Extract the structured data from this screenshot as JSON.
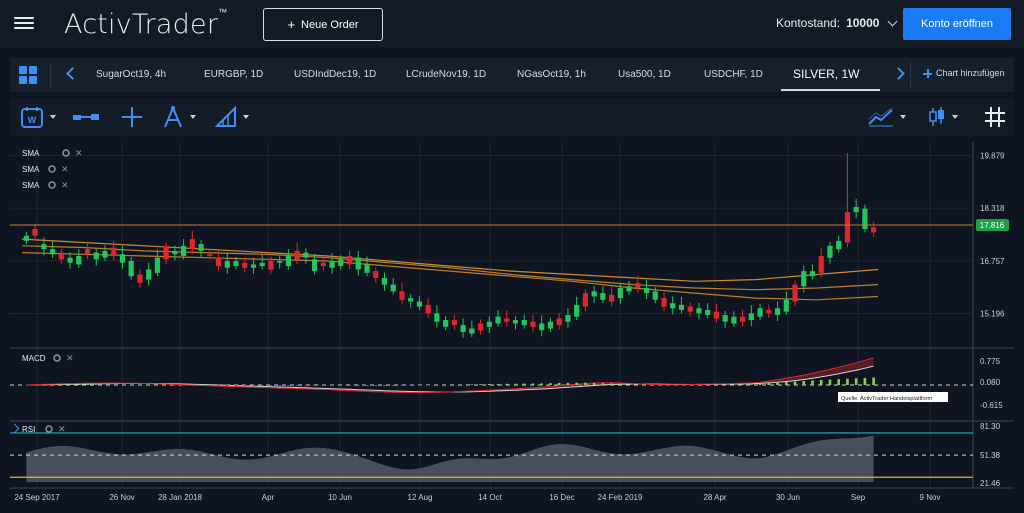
{
  "app": {
    "logo": "ActivTrader",
    "logo_mark": "™",
    "new_order_label": "Neue Order",
    "account_label": "Kontostand:",
    "account_value": "10000",
    "open_account_label": "Konto eröffnen"
  },
  "tabs": [
    {
      "label": "SugarOct19, 4h"
    },
    {
      "label": "EURGBP, 1D"
    },
    {
      "label": "USDIndDec19, 1D"
    },
    {
      "label": "LCrudeNov19, 1D"
    },
    {
      "label": "NGasOct19, 1h"
    },
    {
      "label": "Usa500, 1D"
    },
    {
      "label": "USDCHF, 1D"
    },
    {
      "label": "SILVER, 1W",
      "active": true
    }
  ],
  "add_chart_label": "Chart hinzufügen",
  "toolbar": {
    "icons": [
      "calendar-week-icon",
      "chart-type-icon",
      "crosshair-icon",
      "drawing-tool-icon",
      "ruler-tool-icon",
      "indicators-icon",
      "candlestick-icon",
      "grid-icon"
    ],
    "period_letter": "W"
  },
  "indicators": {
    "main": [
      "SMA",
      "SMA",
      "SMA"
    ],
    "macd_label": "MACD",
    "rsi_label": "RSI",
    "source_label": "Quelle: ActivTrader Handelsplattform"
  },
  "colors": {
    "up": "#22c55e",
    "down": "#e0262c",
    "sma": "#d08a2c",
    "price_line": "#c97a2a",
    "accent": "#1a7cf5",
    "rsi_upper": "#19b6c4",
    "rsi_lower": "#e6b41e"
  },
  "chart_data": {
    "type": "candlestick",
    "symbol": "SILVER, 1W",
    "x_labels": [
      "24 Sep 2017",
      "26 Nov",
      "28 Jan 2018",
      "Apr",
      "10 Jun",
      "12 Aug",
      "14 Oct",
      "16 Dec",
      "24 Feb 2019",
      "28 Apr",
      "30 Jun",
      "Sep",
      "9 Nov"
    ],
    "price_axis": [
      19.879,
      18.318,
      16.757,
      15.196
    ],
    "ylim": [
      14.35,
      20.1
    ],
    "current_price": 17.816,
    "sma_series": [
      [
        17.4,
        17.3,
        17.2,
        17.1,
        17.0,
        16.9,
        16.75,
        16.6,
        16.45,
        16.35,
        16.25,
        16.15,
        16.2,
        16.35,
        16.5
      ],
      [
        17.2,
        17.15,
        17.05,
        17.0,
        16.95,
        16.85,
        16.7,
        16.55,
        16.35,
        16.2,
        16.05,
        15.95,
        15.9,
        15.95,
        16.05
      ],
      [
        17.0,
        16.95,
        16.9,
        16.85,
        16.8,
        16.75,
        16.6,
        16.45,
        16.3,
        16.15,
        15.95,
        15.8,
        15.65,
        15.6,
        15.7
      ]
    ],
    "candles": [
      [
        17.35,
        17.5
      ],
      [
        17.5,
        17.7
      ],
      [
        17.1,
        17.25
      ],
      [
        16.95,
        17.1
      ],
      [
        16.8,
        17.0
      ],
      [
        16.7,
        16.85
      ],
      [
        16.65,
        16.9
      ],
      [
        16.95,
        17.1
      ],
      [
        16.8,
        17.0
      ],
      [
        16.85,
        17.05
      ],
      [
        16.9,
        17.15
      ],
      [
        16.7,
        16.95
      ],
      [
        16.3,
        16.75
      ],
      [
        16.1,
        16.35
      ],
      [
        16.2,
        16.5
      ],
      [
        16.4,
        16.85
      ],
      [
        16.8,
        17.2
      ],
      [
        16.95,
        17.05
      ],
      [
        16.9,
        17.2
      ],
      [
        17.1,
        17.4
      ],
      [
        17.05,
        17.25
      ],
      [
        16.95,
        16.9
      ],
      [
        16.6,
        16.85
      ],
      [
        16.55,
        16.75
      ],
      [
        16.6,
        16.75
      ],
      [
        16.55,
        16.7
      ],
      [
        16.55,
        16.65
      ],
      [
        16.6,
        16.7
      ],
      [
        16.5,
        16.75
      ],
      [
        16.7,
        16.75
      ],
      [
        16.6,
        16.9
      ],
      [
        16.8,
        17.05
      ],
      [
        16.85,
        17.0
      ],
      [
        16.45,
        16.8
      ],
      [
        16.6,
        16.7
      ],
      [
        16.55,
        16.75
      ],
      [
        16.6,
        16.8
      ],
      [
        16.65,
        16.9
      ],
      [
        16.5,
        16.85
      ],
      [
        16.4,
        16.65
      ],
      [
        16.25,
        16.45
      ],
      [
        16.05,
        16.25
      ],
      [
        15.85,
        16.05
      ],
      [
        15.6,
        15.85
      ],
      [
        15.55,
        15.65
      ],
      [
        15.4,
        15.55
      ],
      [
        15.2,
        15.45
      ],
      [
        14.95,
        15.2
      ],
      [
        14.8,
        15.0
      ],
      [
        14.85,
        15.0
      ],
      [
        14.65,
        14.85
      ],
      [
        14.6,
        14.75
      ],
      [
        14.7,
        14.9
      ],
      [
        14.8,
        14.95
      ],
      [
        14.9,
        15.1
      ],
      [
        14.95,
        15.05
      ],
      [
        14.9,
        15.0
      ],
      [
        14.85,
        15.0
      ],
      [
        14.8,
        14.95
      ],
      [
        14.7,
        14.9
      ],
      [
        14.75,
        14.95
      ],
      [
        14.85,
        15.05
      ],
      [
        14.95,
        15.15
      ],
      [
        15.1,
        15.45
      ],
      [
        15.4,
        15.8
      ],
      [
        15.7,
        15.85
      ],
      [
        15.6,
        15.8
      ],
      [
        15.55,
        15.75
      ],
      [
        15.65,
        15.95
      ],
      [
        15.85,
        16.0
      ],
      [
        15.95,
        16.1
      ],
      [
        15.8,
        15.95
      ],
      [
        15.6,
        15.85
      ],
      [
        15.4,
        15.65
      ],
      [
        15.35,
        15.5
      ],
      [
        15.3,
        15.45
      ],
      [
        15.25,
        15.4
      ],
      [
        15.2,
        15.35
      ],
      [
        15.15,
        15.3
      ],
      [
        15.05,
        15.25
      ],
      [
        14.95,
        15.15
      ],
      [
        14.9,
        15.1
      ],
      [
        14.95,
        15.1
      ],
      [
        15.0,
        15.2
      ],
      [
        15.1,
        15.35
      ],
      [
        15.2,
        15.3
      ],
      [
        15.15,
        15.35
      ],
      [
        15.25,
        15.6
      ],
      [
        15.55,
        16.05
      ],
      [
        16.0,
        16.45
      ],
      [
        16.3,
        16.45
      ],
      [
        16.4,
        16.9
      ],
      [
        16.85,
        17.2
      ],
      [
        17.1,
        17.35
      ],
      [
        17.3,
        18.2
      ],
      [
        18.2,
        18.35
      ],
      [
        17.7,
        18.3
      ],
      [
        17.6,
        17.75
      ]
    ],
    "macd_axis": [
      0.775,
      0.08,
      -0.615
    ],
    "rsi_axis": [
      81.3,
      51.38,
      21.46
    ]
  }
}
